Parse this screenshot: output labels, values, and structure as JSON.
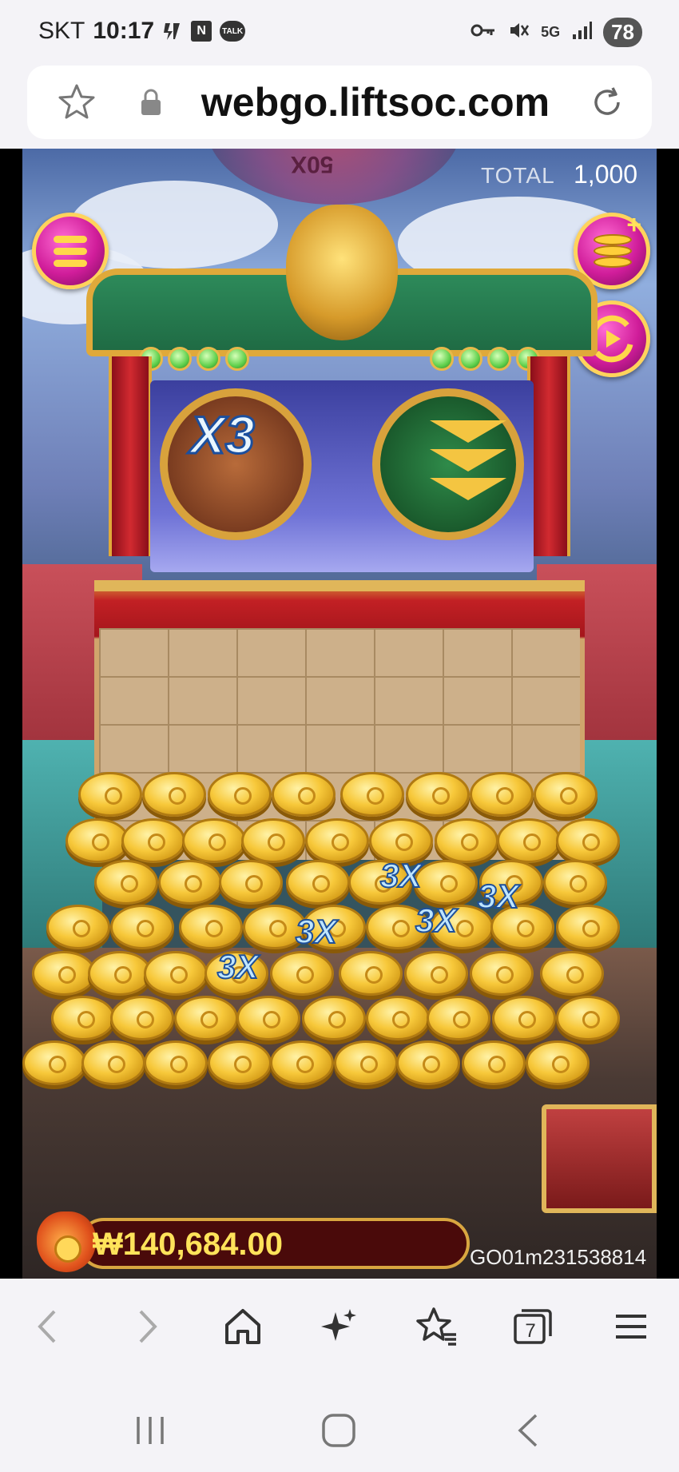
{
  "status_bar": {
    "carrier": "SKT",
    "time": "10:17",
    "network": "5G",
    "battery": "78",
    "icons": [
      "voltage-icon",
      "naver-icon",
      "talk-icon",
      "key-icon",
      "mute-icon",
      "signal-icon"
    ]
  },
  "browser": {
    "url": "webgo.liftsoc.com",
    "tab_count": "7"
  },
  "game": {
    "wheel_label": "50X",
    "total_label": "TOTAL",
    "total_value": "1,000",
    "multiplier_badge": "X3",
    "coin_multiplier_label": "3X",
    "balance": "₩140,684.00",
    "game_id": "GO01m231538814"
  },
  "nav": {
    "items": [
      "back-icon",
      "forward-icon",
      "home-icon",
      "ai-sparkle-icon",
      "bookmarks-icon",
      "tabs-icon",
      "menu-icon"
    ]
  },
  "system_nav": {
    "items": [
      "recent-apps-icon",
      "home-button-icon",
      "system-back-icon"
    ]
  },
  "colors": {
    "accent_magenta": "#d01d9a",
    "gold": "#ffd35c",
    "balance_text": "#ffe35a"
  }
}
